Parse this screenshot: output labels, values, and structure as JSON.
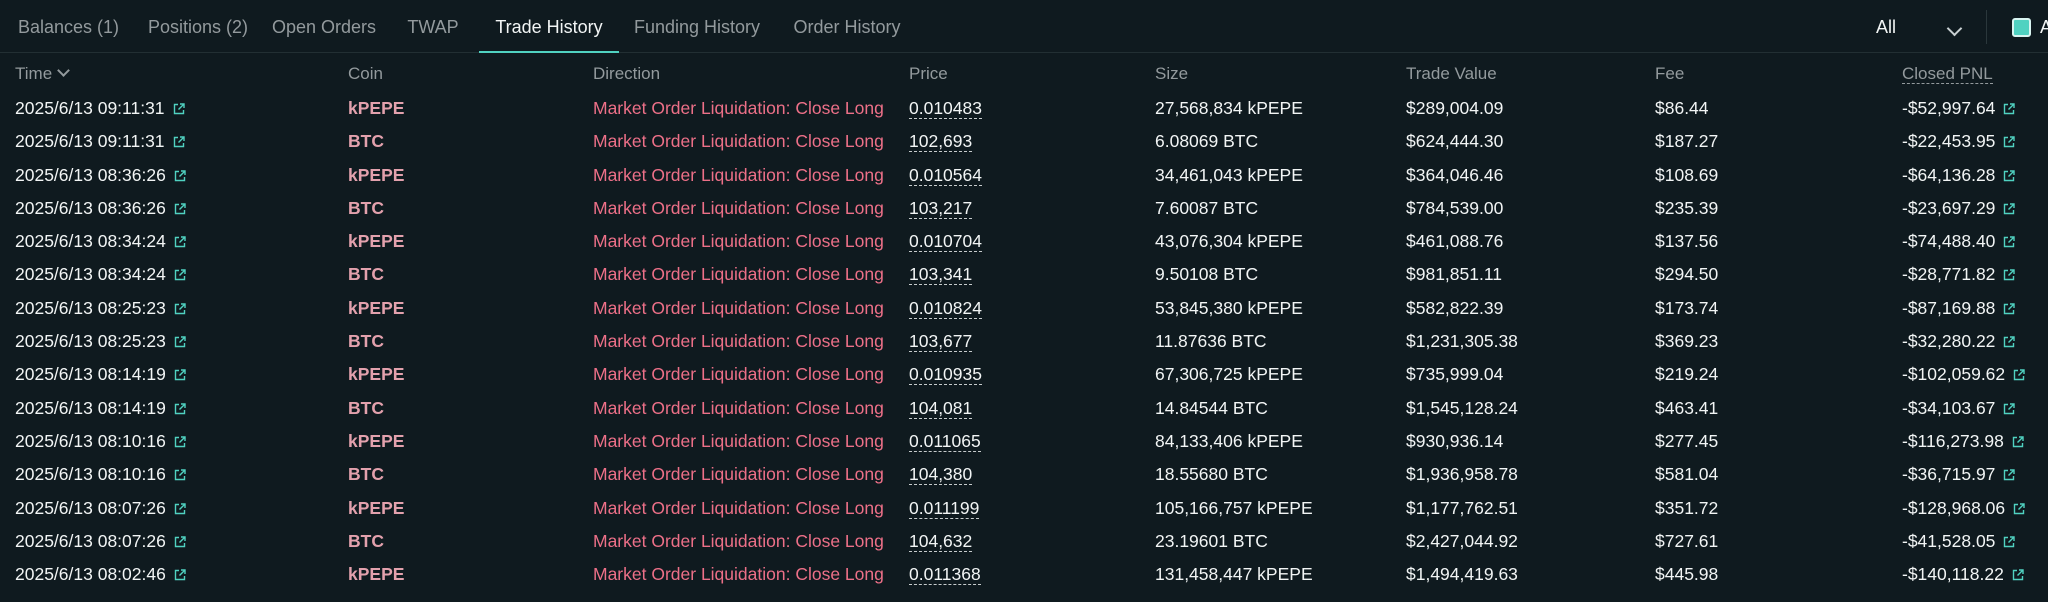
{
  "tabs": [
    {
      "label": "Balances (1)",
      "active": false
    },
    {
      "label": "Positions (2)",
      "active": false
    },
    {
      "label": "Open Orders",
      "active": false
    },
    {
      "label": "TWAP",
      "active": false
    },
    {
      "label": "Trade History",
      "active": true
    },
    {
      "label": "Funding History",
      "active": false
    },
    {
      "label": "Order History",
      "active": false
    }
  ],
  "filter": {
    "selected": "All"
  },
  "checkbox": {
    "label": "A",
    "checked": true
  },
  "columns": {
    "time": "Time",
    "coin": "Coin",
    "direction": "Direction",
    "price": "Price",
    "size": "Size",
    "trade_value": "Trade Value",
    "fee": "Fee",
    "closed_pnl": "Closed PNL"
  },
  "rows": [
    {
      "time": "2025/6/13 09:11:31",
      "coin": "kPEPE",
      "direction": "Market Order Liquidation: Close Long",
      "price": "0.010483",
      "size": "27,568,834 kPEPE",
      "trade_value": "$289,004.09",
      "fee": "$86.44",
      "closed_pnl": "-$52,997.64"
    },
    {
      "time": "2025/6/13 09:11:31",
      "coin": "BTC",
      "direction": "Market Order Liquidation: Close Long",
      "price": "102,693",
      "size": "6.08069 BTC",
      "trade_value": "$624,444.30",
      "fee": "$187.27",
      "closed_pnl": "-$22,453.95"
    },
    {
      "time": "2025/6/13 08:36:26",
      "coin": "kPEPE",
      "direction": "Market Order Liquidation: Close Long",
      "price": "0.010564",
      "size": "34,461,043 kPEPE",
      "trade_value": "$364,046.46",
      "fee": "$108.69",
      "closed_pnl": "-$64,136.28"
    },
    {
      "time": "2025/6/13 08:36:26",
      "coin": "BTC",
      "direction": "Market Order Liquidation: Close Long",
      "price": "103,217",
      "size": "7.60087 BTC",
      "trade_value": "$784,539.00",
      "fee": "$235.39",
      "closed_pnl": "-$23,697.29"
    },
    {
      "time": "2025/6/13 08:34:24",
      "coin": "kPEPE",
      "direction": "Market Order Liquidation: Close Long",
      "price": "0.010704",
      "size": "43,076,304 kPEPE",
      "trade_value": "$461,088.76",
      "fee": "$137.56",
      "closed_pnl": "-$74,488.40"
    },
    {
      "time": "2025/6/13 08:34:24",
      "coin": "BTC",
      "direction": "Market Order Liquidation: Close Long",
      "price": "103,341",
      "size": "9.50108 BTC",
      "trade_value": "$981,851.11",
      "fee": "$294.50",
      "closed_pnl": "-$28,771.82"
    },
    {
      "time": "2025/6/13 08:25:23",
      "coin": "kPEPE",
      "direction": "Market Order Liquidation: Close Long",
      "price": "0.010824",
      "size": "53,845,380 kPEPE",
      "trade_value": "$582,822.39",
      "fee": "$173.74",
      "closed_pnl": "-$87,169.88"
    },
    {
      "time": "2025/6/13 08:25:23",
      "coin": "BTC",
      "direction": "Market Order Liquidation: Close Long",
      "price": "103,677",
      "size": "11.87636 BTC",
      "trade_value": "$1,231,305.38",
      "fee": "$369.23",
      "closed_pnl": "-$32,280.22"
    },
    {
      "time": "2025/6/13 08:14:19",
      "coin": "kPEPE",
      "direction": "Market Order Liquidation: Close Long",
      "price": "0.010935",
      "size": "67,306,725 kPEPE",
      "trade_value": "$735,999.04",
      "fee": "$219.24",
      "closed_pnl": "-$102,059.62"
    },
    {
      "time": "2025/6/13 08:14:19",
      "coin": "BTC",
      "direction": "Market Order Liquidation: Close Long",
      "price": "104,081",
      "size": "14.84544 BTC",
      "trade_value": "$1,545,128.24",
      "fee": "$463.41",
      "closed_pnl": "-$34,103.67"
    },
    {
      "time": "2025/6/13 08:10:16",
      "coin": "kPEPE",
      "direction": "Market Order Liquidation: Close Long",
      "price": "0.011065",
      "size": "84,133,406 kPEPE",
      "trade_value": "$930,936.14",
      "fee": "$277.45",
      "closed_pnl": "-$116,273.98"
    },
    {
      "time": "2025/6/13 08:10:16",
      "coin": "BTC",
      "direction": "Market Order Liquidation: Close Long",
      "price": "104,380",
      "size": "18.55680 BTC",
      "trade_value": "$1,936,958.78",
      "fee": "$581.04",
      "closed_pnl": "-$36,715.97"
    },
    {
      "time": "2025/6/13 08:07:26",
      "coin": "kPEPE",
      "direction": "Market Order Liquidation: Close Long",
      "price": "0.011199",
      "size": "105,166,757 kPEPE",
      "trade_value": "$1,177,762.51",
      "fee": "$351.72",
      "closed_pnl": "-$128,968.06"
    },
    {
      "time": "2025/6/13 08:07:26",
      "coin": "BTC",
      "direction": "Market Order Liquidation: Close Long",
      "price": "104,632",
      "size": "23.19601 BTC",
      "trade_value": "$2,427,044.92",
      "fee": "$727.61",
      "closed_pnl": "-$41,528.05"
    },
    {
      "time": "2025/6/13 08:02:46",
      "coin": "kPEPE",
      "direction": "Market Order Liquidation: Close Long",
      "price": "0.011368",
      "size": "131,458,447 kPEPE",
      "trade_value": "$1,494,419.63",
      "fee": "$445.98",
      "closed_pnl": "-$140,118.22"
    }
  ],
  "colors": {
    "accent": "#50d2c1",
    "short_red": "#ed7088",
    "coin_pink": "#e3a1ad",
    "background": "#0f1a1f"
  }
}
